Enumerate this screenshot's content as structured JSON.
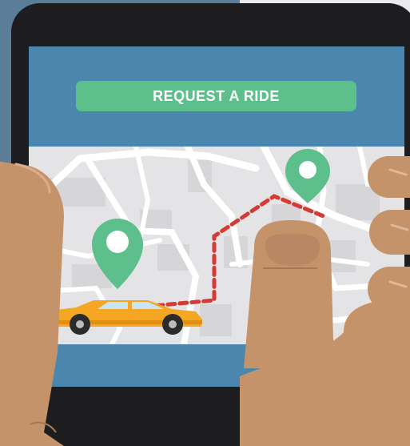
{
  "header": {
    "request_button_label": "REQUEST A RIDE"
  },
  "icons": {
    "pickup_pin": "location-pin-icon",
    "destination_pin": "location-pin-icon",
    "vehicle": "car-icon"
  },
  "colors": {
    "accent_green": "#5cbf8c",
    "screen_blue": "#4a86ad",
    "phone_body": "#1d1d1f",
    "map_background": "#e4e3e5",
    "map_roads": "#ffffff",
    "route_line": "#d43b35",
    "car_body": "#f5a623",
    "skin": "#c4936a"
  }
}
